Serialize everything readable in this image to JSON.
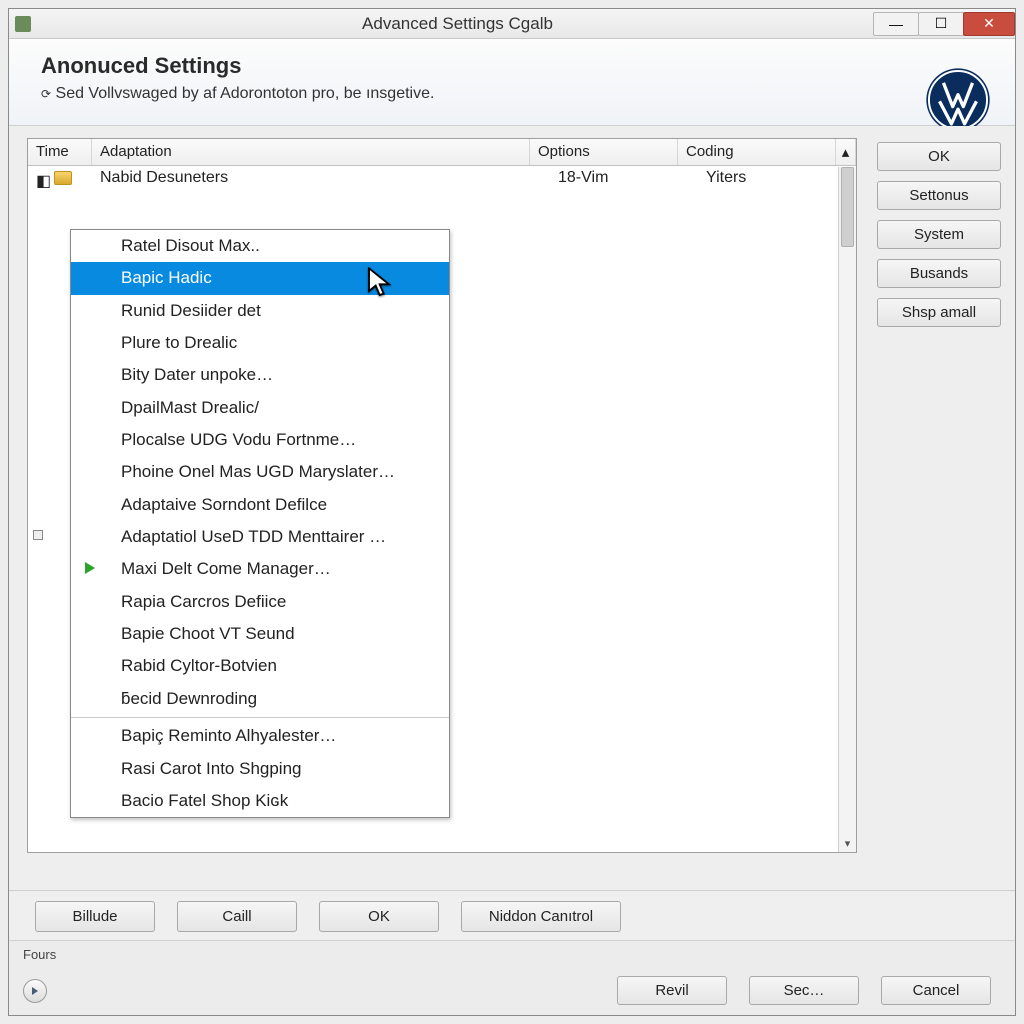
{
  "titlebar": {
    "title": "Advanced Settings Cgalb"
  },
  "header": {
    "heading": "Anonuced Settings",
    "subtitle": "Sed Vollvswaged by af Adorontoton pro, be ınsgetive."
  },
  "table": {
    "columns": {
      "time": "Time",
      "adaptation": "Adaptation",
      "options": "Options",
      "coding": "Coding"
    },
    "first_row": {
      "adaptation": "Nabid Desuneters",
      "options": "18-Vim",
      "coding": "Yiters"
    },
    "scroll_up_glyph": "▴",
    "scroll_down_glyph": "▾"
  },
  "dropdown": {
    "items": [
      "Ratel Disout Max..",
      "Bapic Hadic",
      "Runid Desiider det",
      "Plure to Drealic",
      "Bity Dater unpoke…",
      "DpailMast Drealic/",
      "Plocalse UDG Vodu Fortnme…",
      "Phoine Onel Mas UGD Maryslater…",
      "Adaptaive Sorndont Defilce",
      "Adaptatiol UseD TDD Menttairer …",
      "Maxi Delt Come Manager…",
      "Rapia Carcros Defiice",
      "Bapie Choot VT Seund",
      "Rabid Cyltor-Botvien",
      "ƃecid Dewnroding"
    ],
    "selected_index": 1,
    "tail_items": [
      "Bapiç Reminto Alhyalester…",
      "Rasi Carot Into Shgping",
      "Bacio Fatel Shop Kiɢk"
    ]
  },
  "side_buttons": [
    "OK",
    "Settonus",
    "System",
    "Busands",
    "Shsp amall"
  ],
  "bottom_buttons": [
    "Billude",
    "Caill",
    "OK",
    "Niddon Canıtrol"
  ],
  "status_label": "Fours",
  "footer_buttons": [
    "Revil",
    "Sec…",
    "Cancel"
  ]
}
